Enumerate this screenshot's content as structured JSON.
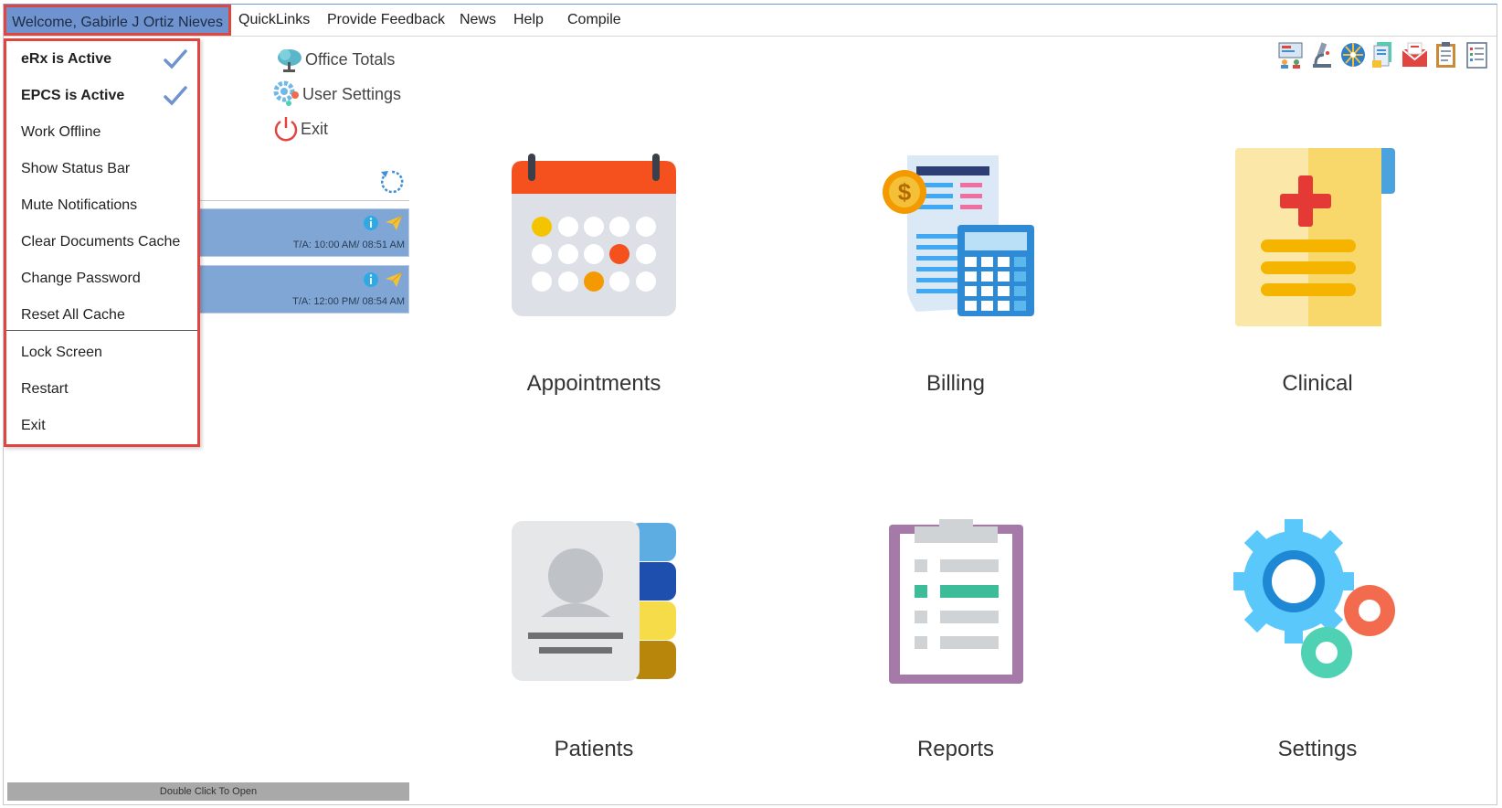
{
  "menubar": {
    "welcome": "Welcome, Gabirle J Ortiz Nieves",
    "items": [
      {
        "label": "QuickLinks"
      },
      {
        "label": "Provide Feedback"
      },
      {
        "label": "News"
      },
      {
        "label": "Help"
      },
      {
        "label": "Compile"
      }
    ]
  },
  "dropdown": {
    "items": [
      {
        "label": "eRx is Active",
        "checked": true
      },
      {
        "label": "EPCS is Active",
        "checked": true
      },
      {
        "label": "Work Offline"
      },
      {
        "label": "Show Status Bar"
      },
      {
        "label": "Mute Notifications"
      },
      {
        "label": "Clear Documents Cache"
      },
      {
        "label": "Change Password"
      },
      {
        "label": "Reset All Cache"
      },
      {
        "label": "Lock Screen"
      },
      {
        "label": "Restart"
      },
      {
        "label": "Exit"
      }
    ]
  },
  "quicklinks": {
    "office_totals": "Office Totals",
    "user_settings": "User Settings",
    "exit": "Exit"
  },
  "appointments_list": [
    {
      "ta": "T/A: 10:00 AM/ 08:51 AM"
    },
    {
      "ta": "T/A: 12:00 PM/ 08:54 AM"
    }
  ],
  "status_bar": {
    "label": "Double Click To Open"
  },
  "tiles": {
    "appointments": "Appointments",
    "billing": "Billing",
    "clinical": "Clinical",
    "patients": "Patients",
    "reports": "Reports",
    "settings": "Settings"
  },
  "colors": {
    "accent_blue": "#6f93cf",
    "highlight_red": "#e0463f",
    "card_blue": "#7fa6d4"
  }
}
